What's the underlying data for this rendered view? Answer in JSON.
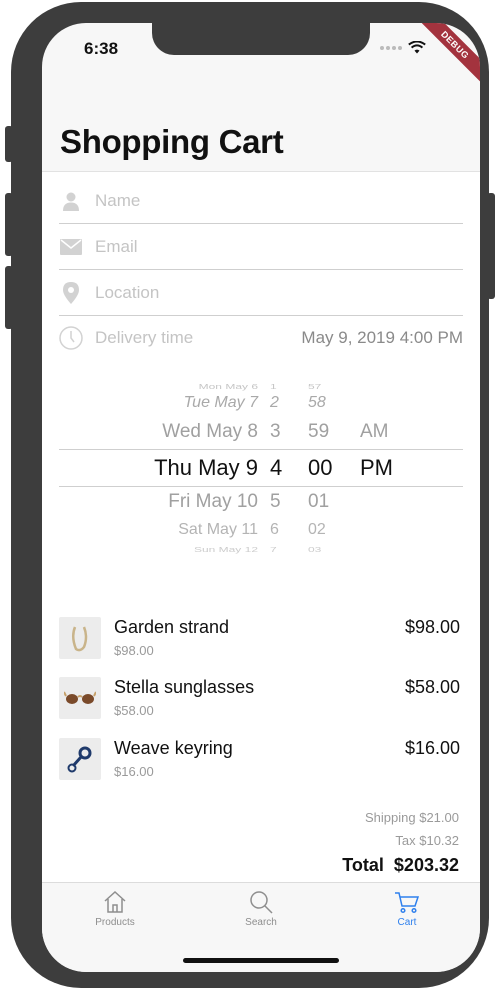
{
  "status_bar": {
    "time": "6:38",
    "debug_label": "DEBUG"
  },
  "page_title": "Shopping Cart",
  "form": {
    "name_placeholder": "Name",
    "email_placeholder": "Email",
    "location_placeholder": "Location",
    "delivery_label": "Delivery time",
    "delivery_value": "May 9, 2019 4:00 PM"
  },
  "picker": {
    "rows": [
      {
        "date": "Mon May 6",
        "hour": "1",
        "minute": "57",
        "ampm": ""
      },
      {
        "date": "Tue May 7",
        "hour": "2",
        "minute": "58",
        "ampm": ""
      },
      {
        "date": "Wed May 8",
        "hour": "3",
        "minute": "59",
        "ampm": "AM"
      },
      {
        "date": "Thu May 9",
        "hour": "4",
        "minute": "00",
        "ampm": "PM"
      },
      {
        "date": "Fri May 10",
        "hour": "5",
        "minute": "01",
        "ampm": ""
      },
      {
        "date": "Sat May 11",
        "hour": "6",
        "minute": "02",
        "ampm": ""
      },
      {
        "date": "Sun May 12",
        "hour": "7",
        "minute": "03",
        "ampm": ""
      }
    ]
  },
  "cart": {
    "items": [
      {
        "name": "Garden strand",
        "unit_price": "$98.00",
        "price": "$98.00",
        "icon": "necklace-icon"
      },
      {
        "name": "Stella sunglasses",
        "unit_price": "$58.00",
        "price": "$58.00",
        "icon": "sunglasses-icon"
      },
      {
        "name": "Weave keyring",
        "unit_price": "$16.00",
        "price": "$16.00",
        "icon": "keyring-icon"
      }
    ],
    "shipping": "Shipping $21.00",
    "tax": "Tax $10.32",
    "total_label": "Total",
    "total_value": "$203.32"
  },
  "tabs": [
    {
      "label": "Products",
      "icon": "home-icon",
      "active": false
    },
    {
      "label": "Search",
      "icon": "search-icon",
      "active": false
    },
    {
      "label": "Cart",
      "icon": "cart-icon",
      "active": true
    }
  ],
  "colors": {
    "accent": "#2f80ed",
    "debug_banner": "#a3333e",
    "frame": "#3d3d3d"
  }
}
